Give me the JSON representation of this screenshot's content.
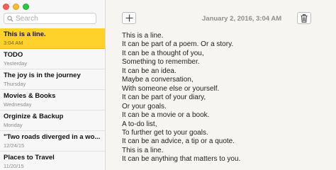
{
  "window": {
    "colors": {
      "close": "#fd5f57",
      "minimize": "#febc2e",
      "maximize": "#28c840",
      "selected": "#fed22b"
    }
  },
  "search": {
    "placeholder": "Search",
    "value": "",
    "icon": "magnifier-icon"
  },
  "notes": [
    {
      "title": "This is a line.",
      "date": "3:04 AM",
      "selected": true
    },
    {
      "title": "TODO",
      "date": "Yesterday"
    },
    {
      "title": "The joy is in the journey",
      "date": "Thursday"
    },
    {
      "title": "Movies & Books",
      "date": "Wednesday"
    },
    {
      "title": "Orginize & Backup",
      "date": "Monday"
    },
    {
      "title": "\"Two roads diverged in a wo...",
      "date": "12/24/15"
    },
    {
      "title": "Places to Travel",
      "date": "11/20/15"
    }
  ],
  "editor": {
    "new_note_icon": "plus-icon",
    "trash_icon": "trash-icon",
    "timestamp": "January 2, 2016, 3:04 AM",
    "lines": [
      "This is a line.",
      "It can be part of a poem. Or a story.",
      "It can be a thought of you,",
      "Something to remember.",
      "It can be an idea.",
      "Maybe a conversation,",
      "With someone else or yourself.",
      "It can be part of your diary,",
      "Or your goals.",
      "It can be a movie or a book.",
      "A to-do list,",
      "To further get to your goals.",
      "It can be an advice, a tip or a quote.",
      "This is a line.",
      "It can be anything that matters to you."
    ]
  }
}
